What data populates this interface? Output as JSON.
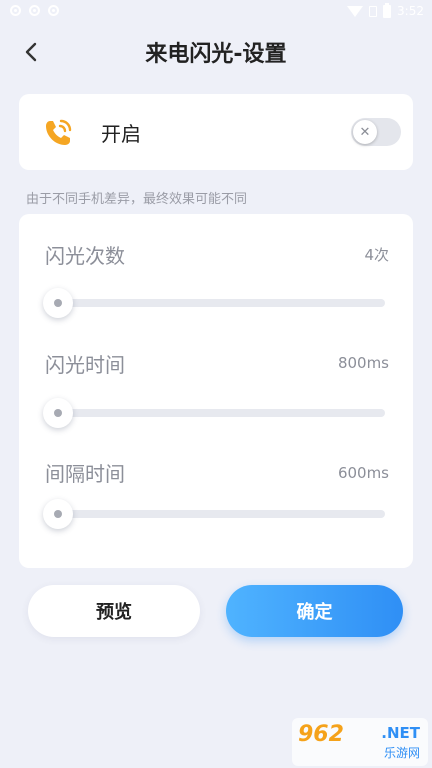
{
  "status_bar": {
    "time": "3:52"
  },
  "header": {
    "title": "来电闪光-设置"
  },
  "toggle_card": {
    "label": "开启",
    "switch_icon": "✕",
    "enabled": false
  },
  "note": "由于不同手机差异，最终效果可能不同",
  "settings": {
    "flash_count": {
      "label": "闪光次数",
      "value": "4次",
      "level": 0
    },
    "flash_time": {
      "label": "闪光时间",
      "value": "800ms",
      "level": 0
    },
    "interval_time": {
      "label": "间隔时间",
      "value": "600ms",
      "level": 0
    }
  },
  "buttons": {
    "preview": "预览",
    "confirm": "确定"
  },
  "watermark": {
    "logo": "962",
    "net": ".NET",
    "sub": "乐游网"
  },
  "colors": {
    "accent": "#2f8ff5",
    "phone_icon": "#f5a623",
    "background": "#eef0f8"
  }
}
